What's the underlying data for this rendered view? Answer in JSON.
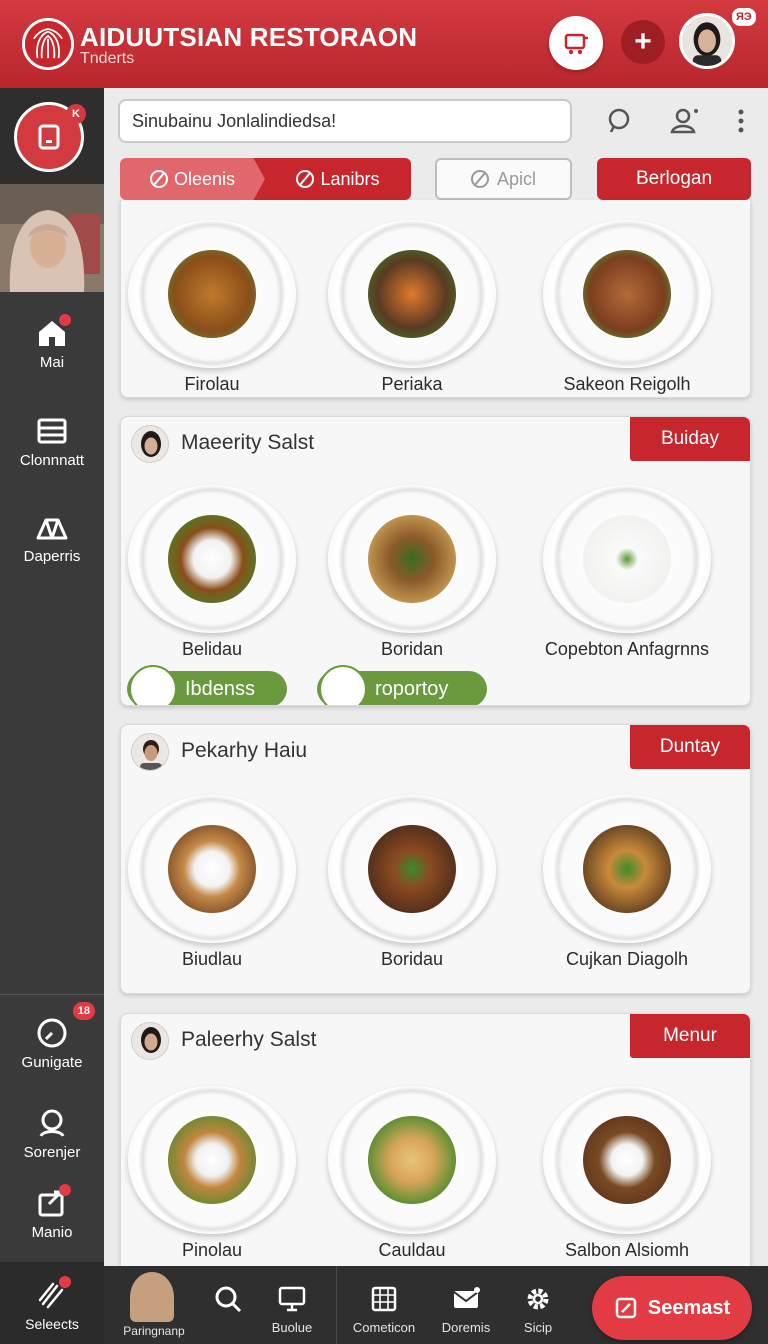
{
  "header": {
    "title": "AIDUUTSIAN RESTORAON",
    "subtitle": "Tnderts",
    "badge": "ЯЭ",
    "accent": "#c8262d"
  },
  "search": {
    "value": "Sinubainu Jonlalindiedsa!"
  },
  "sidebar": {
    "badge": "K",
    "items": [
      {
        "label": "Mai",
        "icon": "home-icon"
      },
      {
        "label": "Clonnnatt",
        "icon": "list-icon"
      },
      {
        "label": "Daperris",
        "icon": "tent-icon"
      },
      {
        "label": "Gunigate",
        "icon": "clock-icon",
        "badge": "18"
      },
      {
        "label": "Sorenjer",
        "icon": "search-icon"
      },
      {
        "label": "Manio",
        "icon": "share-icon"
      },
      {
        "label": "Seleects",
        "icon": "rocket-icon"
      }
    ]
  },
  "filters": {
    "tab1": "Oleenis",
    "tab2": "Lanibrs",
    "secondary": "Apicl",
    "primary": "Berlogan"
  },
  "cards": [
    {
      "dishes": [
        "Firolau",
        "Periaka",
        "Sakeon Reigolh"
      ]
    },
    {
      "title": "Maeerity Salst",
      "tag": "Buiday",
      "dishes": [
        "Belidau",
        "Boridan",
        "Copebton Anfagrnns"
      ],
      "pills": [
        "Ibdenss",
        "roportoy"
      ]
    },
    {
      "title": "Pekarhy Haiu",
      "tag": "Duntay",
      "dishes": [
        "Biudlau",
        "Boridau",
        "Cujkan Diagolh"
      ]
    },
    {
      "title": "Paleerhy Salst",
      "tag": "Menur",
      "dishes": [
        "Pinolau",
        "Cauldau",
        "Salbon Alsiomh"
      ]
    }
  ],
  "bottom_bar": {
    "items": [
      {
        "label": "Paringnanp",
        "icon": "avatar"
      },
      {
        "label": "",
        "icon": "search-icon"
      },
      {
        "label": "Buolue",
        "icon": "monitor-icon"
      },
      {
        "label": "Cometicon",
        "icon": "calendar-icon"
      },
      {
        "label": "Doremis",
        "icon": "mail-icon"
      },
      {
        "label": "Sicip",
        "icon": "gear-icon"
      }
    ],
    "cta": "Seemast"
  }
}
